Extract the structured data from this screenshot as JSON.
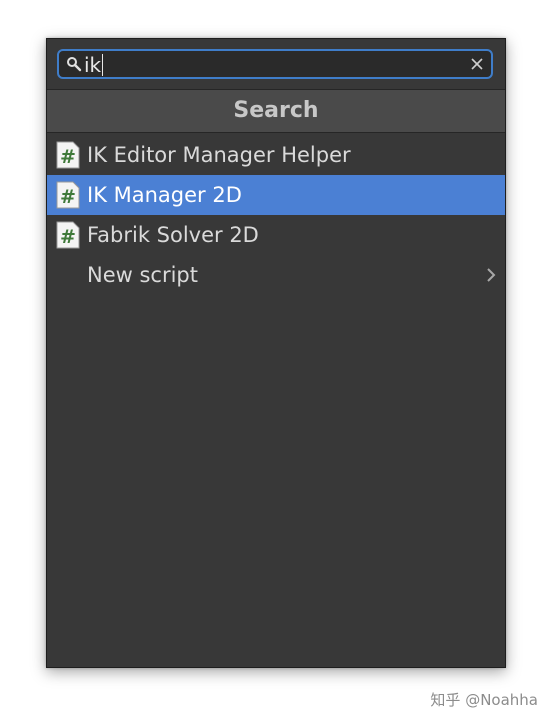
{
  "search": {
    "value": "ik",
    "icon": "search-icon",
    "clear_icon": "close-icon"
  },
  "header": {
    "title": "Search"
  },
  "results": [
    {
      "label": "IK Editor Manager Helper",
      "icon": "csharp-script-icon",
      "selected": false
    },
    {
      "label": "IK Manager 2D",
      "icon": "csharp-script-icon",
      "selected": true
    },
    {
      "label": "Fabrik Solver 2D",
      "icon": "csharp-script-icon",
      "selected": false
    }
  ],
  "new_script": {
    "label": "New script",
    "icon": "chevron-right-icon"
  },
  "watermark": "知乎 @Noahha",
  "colors": {
    "panel_bg": "#383838",
    "header_bg": "#4a4a4a",
    "selection": "#4b80d4",
    "focus_border": "#3f7dc9",
    "script_icon_green": "#3f7a3a"
  }
}
